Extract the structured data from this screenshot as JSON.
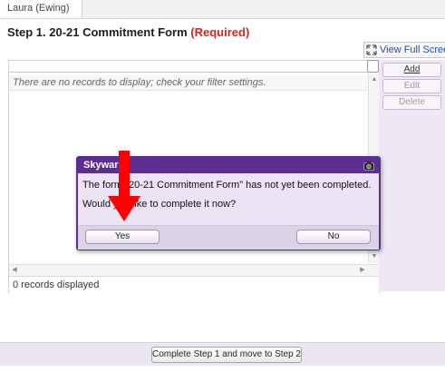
{
  "header": {
    "user_tab": "Laura (Ewing)",
    "step_title": "Step 1. 20-21 Commitment Form",
    "required_label": "(Required)"
  },
  "toolbar": {
    "full_screen_label": "View Full Screen",
    "full_screen_icon": "expand-icon"
  },
  "grid": {
    "empty_message": "There are no records to display; check your filter settings.",
    "records_count": "0 records displayed"
  },
  "side_actions": {
    "add_label": "Add",
    "edit_label": "Edit",
    "delete_label": "Delete"
  },
  "dialog": {
    "title": "Skyward",
    "message_line1": "The form \"20-21 Commitment Form\" has not yet been completed.",
    "message_line2": "Would you like to complete it now?",
    "yes_label": "Yes",
    "no_label": "No",
    "header_icon": "camera-icon"
  },
  "footer": {
    "complete_label": "Complete Step 1 and move to Step 2"
  },
  "colors": {
    "accent_purple": "#5b2e90",
    "required_red": "#e01e1e",
    "annotation_red": "#ff0000",
    "link_blue": "#1c4ea7"
  }
}
